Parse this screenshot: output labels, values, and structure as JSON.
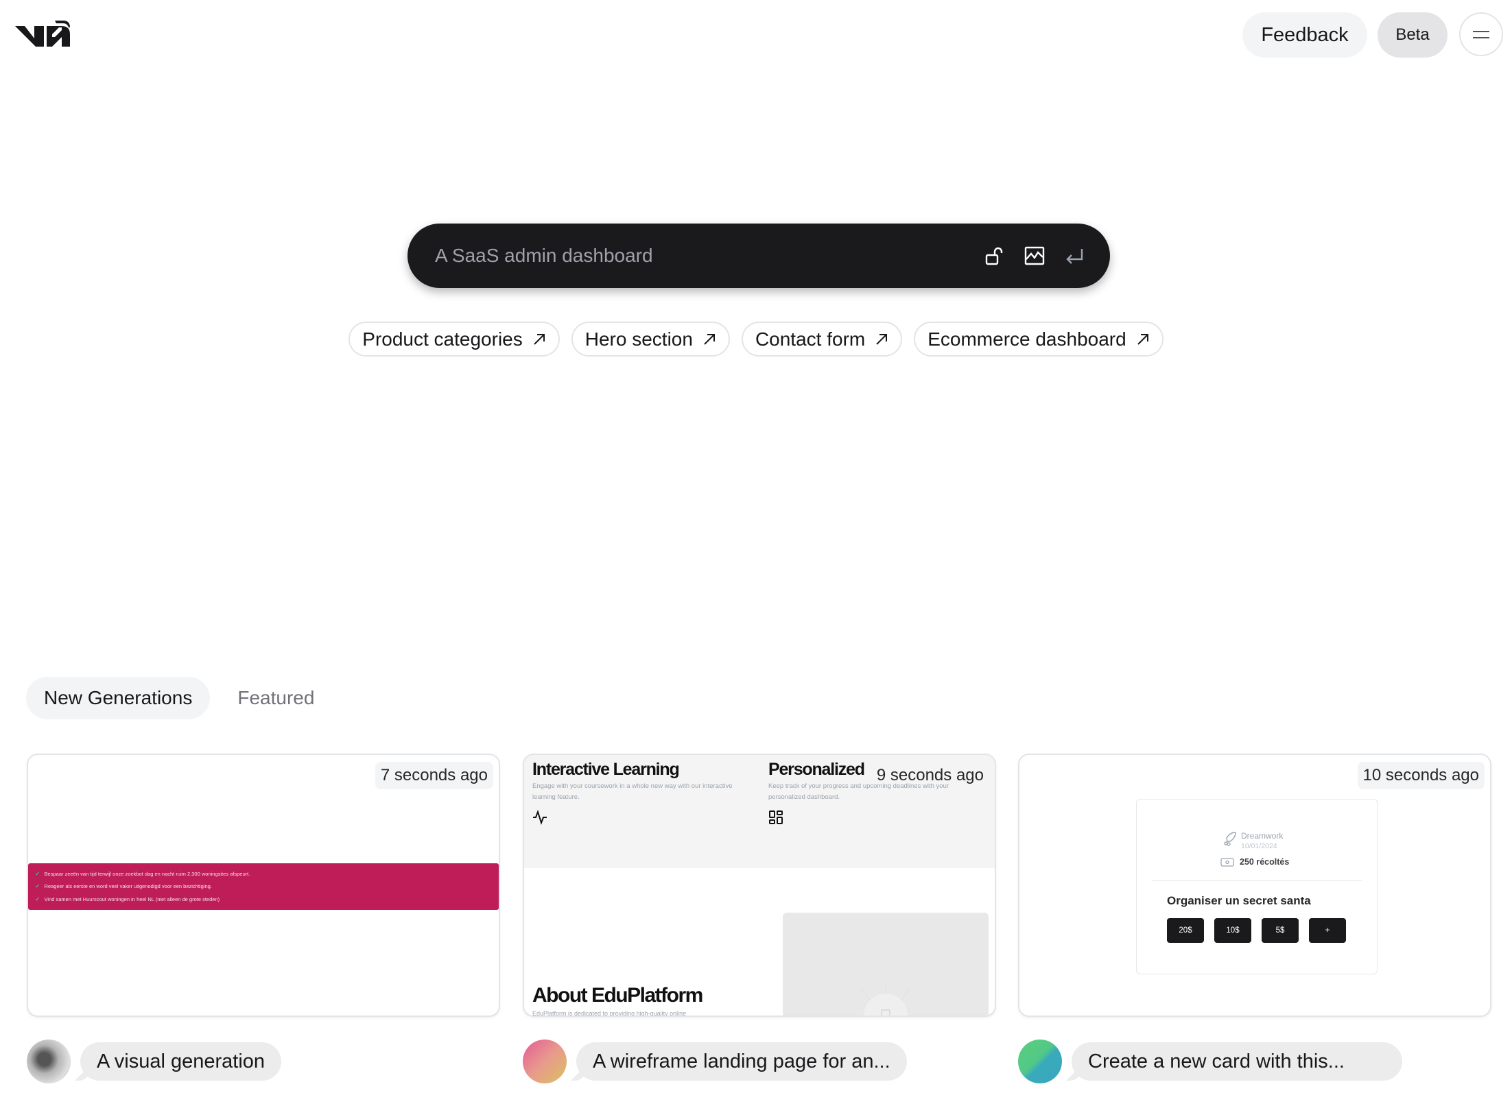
{
  "header": {
    "logo": "v0",
    "feedback_label": "Feedback",
    "beta_label": "Beta",
    "menu_icon": "menu-icon"
  },
  "prompt": {
    "placeholder": "A SaaS admin dashboard",
    "value": "",
    "icons": [
      "unlock-icon",
      "image-upload-icon",
      "enter-icon"
    ]
  },
  "suggestions": [
    {
      "label": "Product categories",
      "icon": "arrow-up-right-icon"
    },
    {
      "label": "Hero section",
      "icon": "arrow-up-right-icon"
    },
    {
      "label": "Contact form",
      "icon": "arrow-up-right-icon"
    },
    {
      "label": "Ecommerce dashboard",
      "icon": "arrow-up-right-icon"
    }
  ],
  "tabs": [
    {
      "label": "New Generations",
      "active": true
    },
    {
      "label": "Featured",
      "active": false
    }
  ],
  "generations": [
    {
      "time": "7 seconds ago",
      "prompt": "A visual generation",
      "preview": {
        "accent": "#be1d58",
        "items": [
          "Bespaar zeeën van tijd terwijl onze zoekbot dag en nacht ruim 2.300 woningsites afspeurt.",
          "Reageer als eerste en word veel vaker uitgenodigd voor een bezichtiging.",
          "Vind samen met Huurscout woningen in heel NL (niet alleen de grote steden)"
        ]
      }
    },
    {
      "time": "9 seconds ago",
      "prompt": "A wireframe landing page for an...",
      "preview": {
        "features": [
          {
            "title": "Interactive Learning",
            "desc": "Engage with your coursework in a whole new way with our interactive learning feature.",
            "icon": "activity-icon"
          },
          {
            "title": "Personalized",
            "desc": "Keep track of your progress and upcoming deadlines with your personalized dashboard.",
            "icon": "layout-grid-icon"
          }
        ],
        "about_title": "About EduPlatform",
        "about_desc": "EduPlatform is dedicated to providing high-quality online"
      }
    },
    {
      "time": "10 seconds ago",
      "prompt": "Create a new card with this...",
      "preview": {
        "project_name": "Dreamwork",
        "project_date": "10/01/2024",
        "raised": "250 récoltés",
        "title": "Organiser un secret santa",
        "amounts": [
          "20$",
          "10$",
          "5$",
          "+"
        ]
      }
    }
  ]
}
